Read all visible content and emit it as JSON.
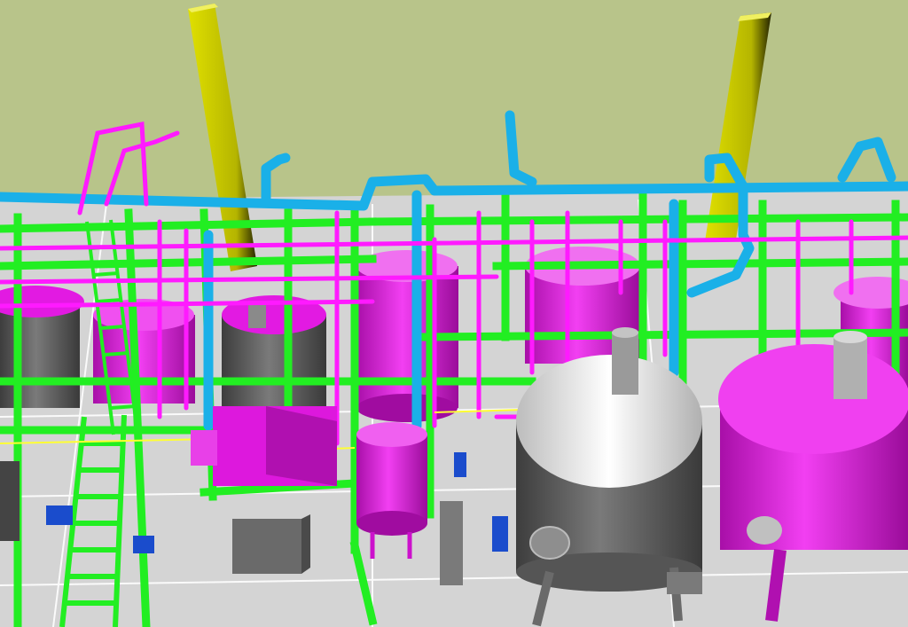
{
  "scene": {
    "kind": "3d-plant-piping-model",
    "colors": {
      "sky": "#b8c48a",
      "floor": "#d4d4d4",
      "floor_grid": "#ffffff",
      "steel_structure": "#22ee22",
      "column": "#c9c900",
      "process_pipe": "#ff1aff",
      "utility_pipe": "#1ab0e8",
      "vessel_magenta": "#e21ae2",
      "vessel_grey": "#5f5f5f",
      "vessel_top_white": "#ececec",
      "pump_blue": "#1a4ccc",
      "pump_grey": "#6a6a6a",
      "signal_line": "#ffff33"
    }
  }
}
